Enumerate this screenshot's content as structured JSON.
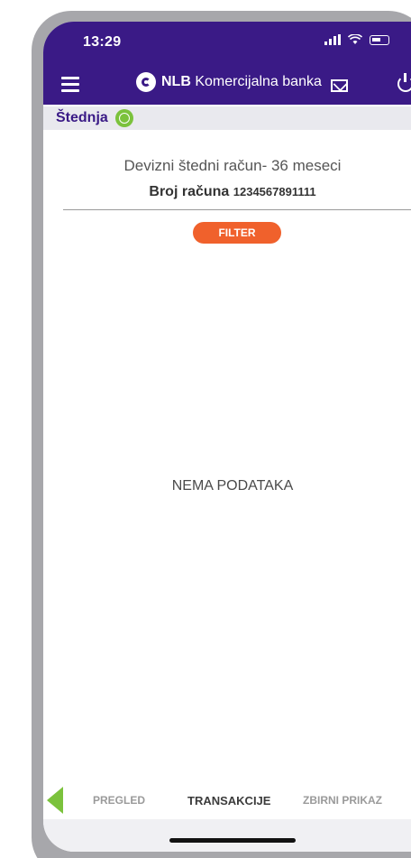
{
  "status": {
    "time": "13:29"
  },
  "header": {
    "brand_strong": "NLB",
    "brand_rest": "Komercijalna banka",
    "menu_icon": "menu-icon",
    "mail_icon": "mail-icon",
    "power_icon": "power-icon"
  },
  "section": {
    "title": "Štednja"
  },
  "account": {
    "name": "Devizni štedni račun- 36 meseci",
    "number_label": "Broj računa",
    "number": "1234567891111"
  },
  "filter": {
    "label": "FILTER"
  },
  "content": {
    "empty_message": "NEMA PODATAKA"
  },
  "tabs": [
    {
      "label": "PREGLED",
      "active": false
    },
    {
      "label": "TRANSAKCIJE",
      "active": true
    },
    {
      "label": "ZBIRNI PRIKAZ",
      "active": false
    }
  ],
  "colors": {
    "topbar": "#3a1a86",
    "accent_green": "#7bc23c",
    "filter_orange": "#f0612c"
  }
}
